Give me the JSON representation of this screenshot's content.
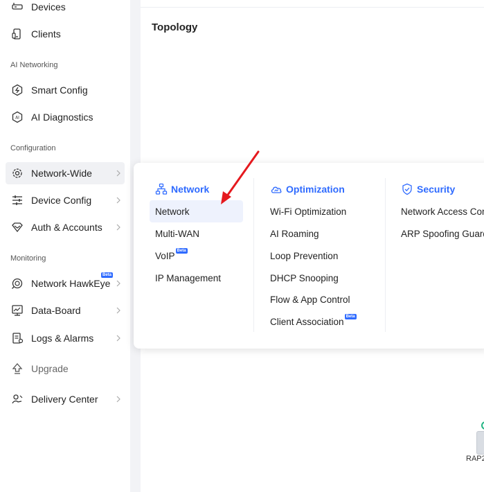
{
  "sidebar": {
    "items_top": [
      {
        "label": "Devices",
        "icon": "devices-icon"
      },
      {
        "label": "Clients",
        "icon": "clients-icon"
      }
    ],
    "sections": {
      "ai": "AI Networking",
      "config": "Configuration",
      "monitoring": "Monitoring"
    },
    "ai_items": [
      {
        "label": "Smart Config",
        "icon": "smart-config-icon"
      },
      {
        "label": "AI Diagnostics",
        "icon": "ai-diagnostics-icon"
      }
    ],
    "config_items": [
      {
        "label": "Network-Wide",
        "icon": "gear-icon",
        "active": true
      },
      {
        "label": "Device Config",
        "icon": "sliders-icon"
      },
      {
        "label": "Auth & Accounts",
        "icon": "auth-icon"
      }
    ],
    "monitoring_items": [
      {
        "label": "Network HawkEye",
        "icon": "hawkeye-icon",
        "badge": "Beta"
      },
      {
        "label": "Data-Board",
        "icon": "data-board-icon"
      },
      {
        "label": "Logs & Alarms",
        "icon": "logs-icon"
      }
    ],
    "upgrade": "Upgrade",
    "delivery": "Delivery Center"
  },
  "main": {
    "title": "Topology",
    "device_label": "RAP2"
  },
  "dropdown": {
    "network": {
      "heading": "Network",
      "links": [
        "Network",
        "Multi-WAN",
        "VoIP",
        "IP Management"
      ],
      "voip_badge": "Beta"
    },
    "optimization": {
      "heading": "Optimization",
      "links": [
        "Wi-Fi Optimization",
        "AI Roaming",
        "Loop Prevention",
        "DHCP Snooping",
        "Flow & App Control",
        "Client Association"
      ],
      "client_badge": "Beta"
    },
    "security": {
      "heading": "Security",
      "links": [
        "Network Access Con",
        "ARP Spoofing Guard"
      ]
    }
  },
  "colors": {
    "accent": "#2f6bff",
    "annotation_arrow": "#e5191e",
    "online": "#23b584"
  }
}
